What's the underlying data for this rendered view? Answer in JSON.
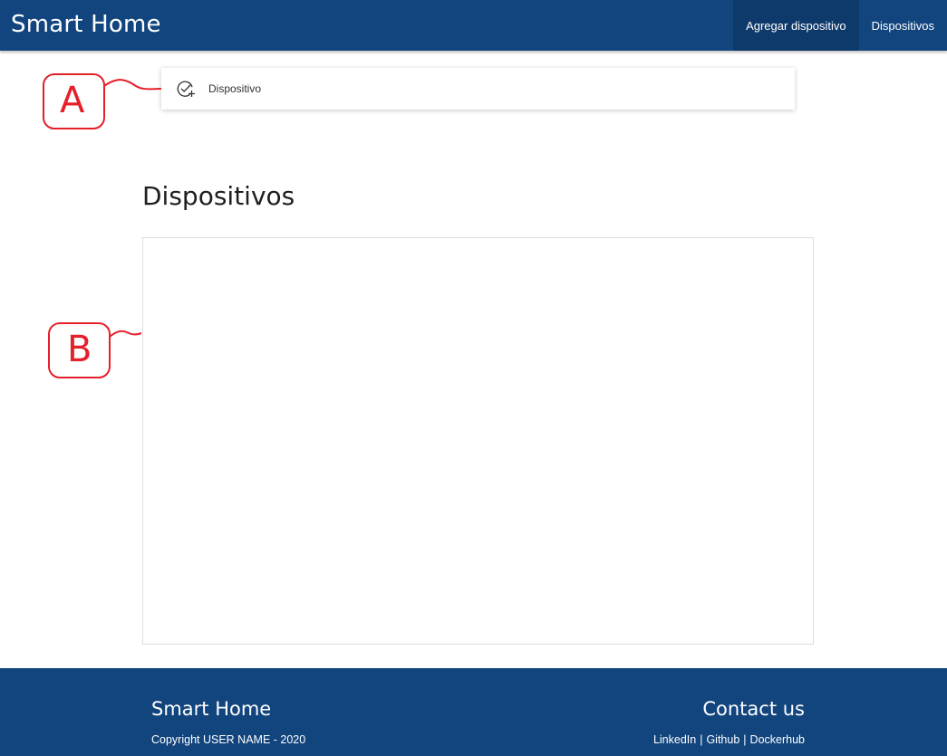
{
  "header": {
    "brand": "Smart Home",
    "nav": [
      {
        "label": "Agregar dispositivo"
      },
      {
        "label": "Dispositivos"
      }
    ]
  },
  "command_bar": {
    "add_button_label": "Dispositivo",
    "add_button_icon": "check-circle-add-icon"
  },
  "main": {
    "section_title": "Dispositivos"
  },
  "annotations": {
    "a_label": "A",
    "b_label": "B",
    "color": "#e4202a"
  },
  "footer": {
    "brand": "Smart Home",
    "copyright": "Copyright USER NAME - 2020",
    "contact_title": "Contact us",
    "links": [
      "LinkedIn",
      "Github",
      "Dockerhub"
    ],
    "separator": "|"
  },
  "colors": {
    "primary": "#12457e",
    "primary_dark": "#0e3a6b"
  }
}
